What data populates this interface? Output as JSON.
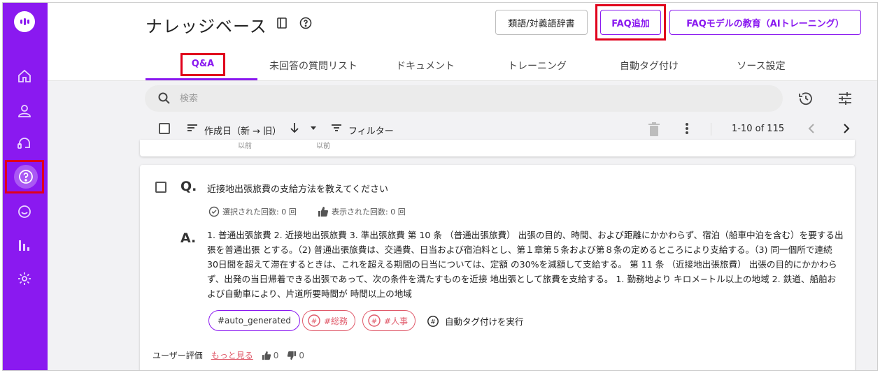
{
  "header": {
    "title": "ナレッジベース",
    "buttons": {
      "synonyms": "類語/対義語辞書",
      "add_faq": "FAQ追加",
      "train_model": "FAQモデルの教育（AIトレーニング）"
    }
  },
  "tabs": [
    {
      "label": "Q&A",
      "active": true
    },
    {
      "label": "未回答の質問リスト"
    },
    {
      "label": "ドキュメント"
    },
    {
      "label": "トレーニング"
    },
    {
      "label": "自動タグ付け"
    },
    {
      "label": "ソース設定"
    }
  ],
  "toolbar": {
    "search_placeholder": "検索",
    "sort_label": "作成日（新 → 旧）",
    "filter_label": "フィルター",
    "pagination": "1-10 of 115"
  },
  "prev_card": {
    "ghost_left": "以前",
    "ghost_right": "以前"
  },
  "faq": {
    "q_label": "Q.",
    "question": "近接地出張旅費の支給方法を教えてください",
    "selected_count": "選択された回数: 0 回",
    "displayed_count": "表示された回数: 0 回",
    "a_label": "A.",
    "answer": "1. 普通出張旅費 2. 近接地出張旅費 3. 準出張旅費 第 10 条 （普通出張旅費） 出張の目的、時間、および距離にかかわらず、宿泊（船車中泊を含む）を要する出張を普通出張 とする。（2) 普通出張旅費は、交通費、日当および宿泊料とし、第１章第５条および第８条の定めるところにより支給する。（3) 同一個所で連続 30日間を超えて滞在するときは、これを超える期間の日当については、定額 の30%を減額して支給する。 第 11 条 （近接地出張旅費） 出張の目的にかかわらず、出発の当日帰着できる出張であって、次の条件を満たすものを近接 地出張として旅費を支給する。 1. 勤務地より キロメ−トル以上の地域 2. 鉄道、船舶および自動車により、片道所要時間が 時間以上の地域",
    "tags": [
      "#auto_generated",
      "#総務",
      "#人事"
    ],
    "auto_tag_label": "自動タグ付けを実行",
    "rating_label": "ユーザー評価",
    "more_label": "もっと見る",
    "likes": "0",
    "dislikes": "0"
  },
  "colors": {
    "brand": "#8a19f0",
    "highlight": "#e0001b",
    "tag_red": "#e05a6a"
  }
}
